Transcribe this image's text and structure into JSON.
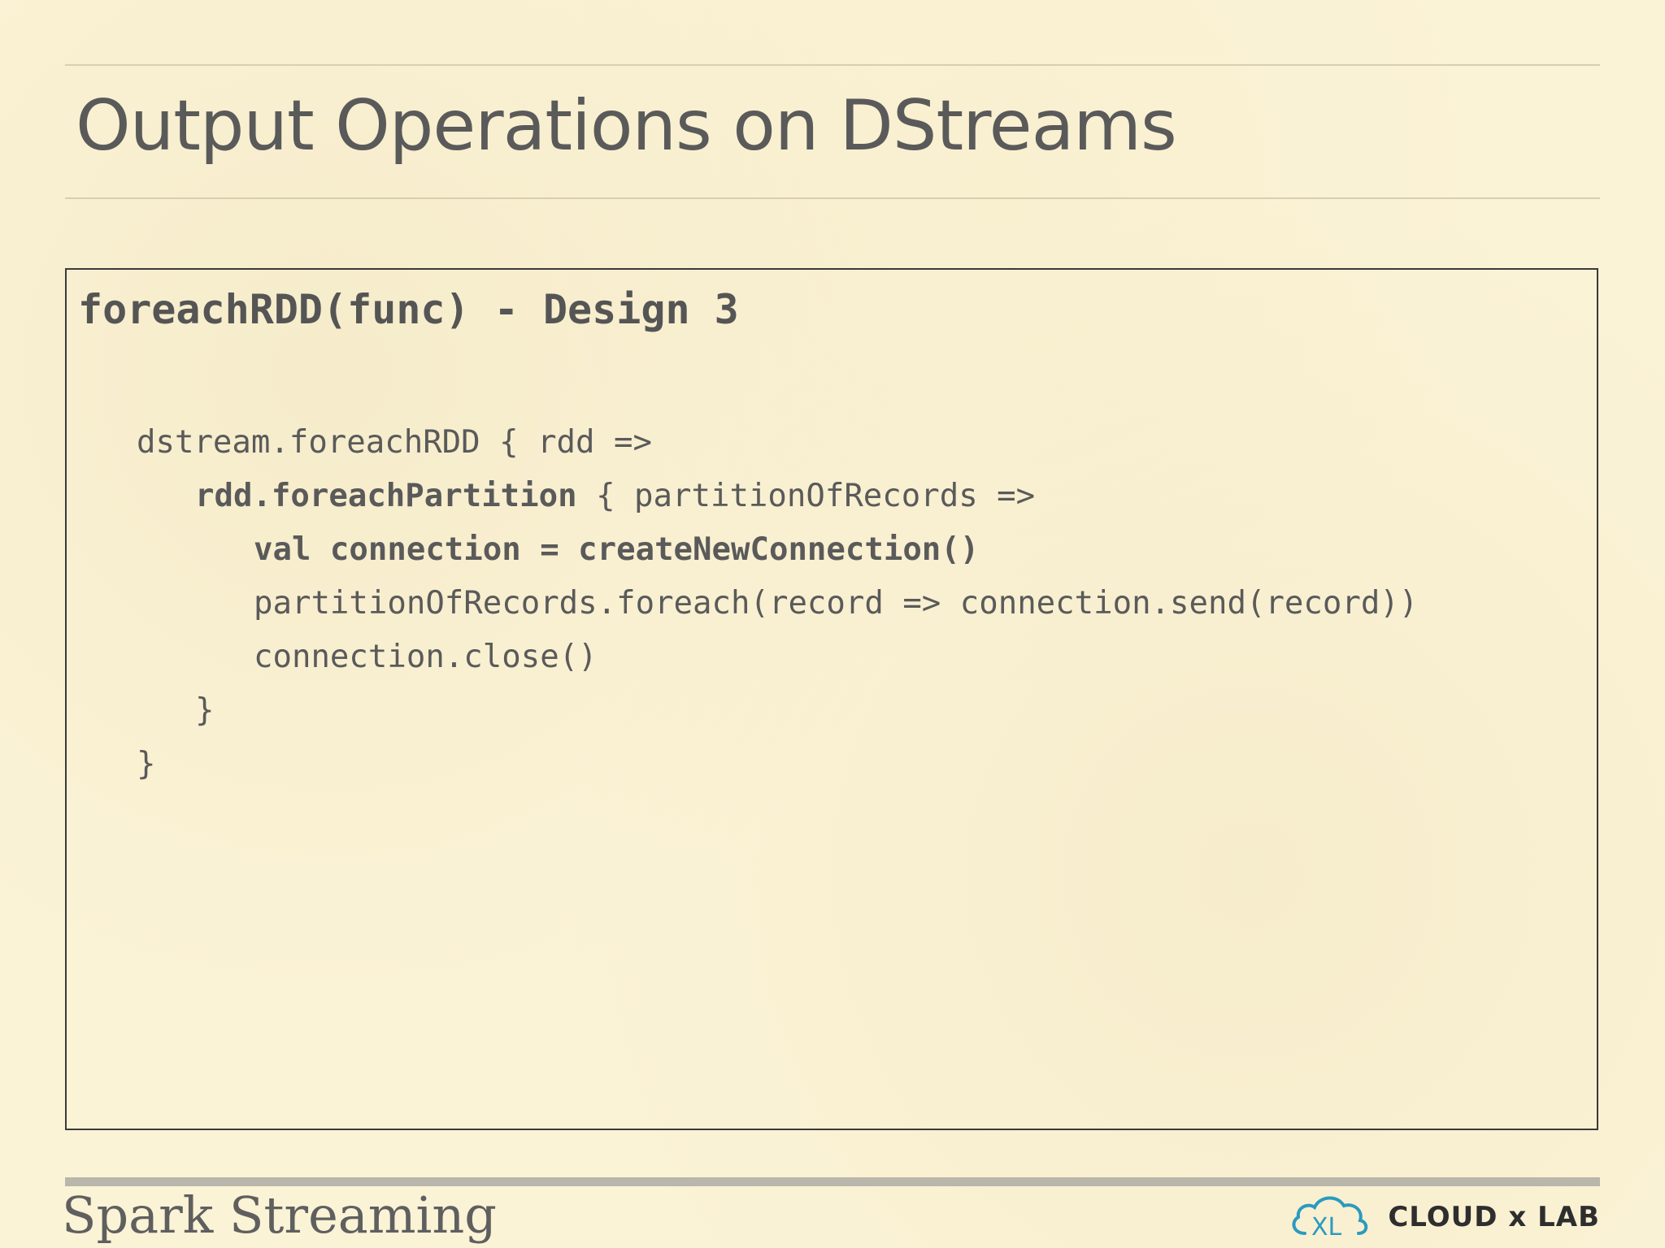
{
  "slide": {
    "title": "Output Operations on DStreams",
    "box_heading": "foreachRDD(func) - Design 3",
    "code_lines": [
      {
        "plain": "dstream.foreachRDD { rdd =>"
      },
      {
        "bold": "rdd.foreachPartition",
        "plain": " { partitionOfRecords =>"
      },
      {
        "bold": "val connection = createNewConnection()"
      },
      {
        "plain": "partitionOfRecords.foreach(record => connection.send(record))"
      },
      {
        "plain": "connection.close()"
      },
      {
        "plain": "}"
      },
      {
        "plain": "}"
      }
    ],
    "footer_title": "Spark Streaming",
    "logo": {
      "icon": "cloud-xl-icon",
      "text": "CLOUD x LAB",
      "colors": {
        "cloud": "#2a9bbf",
        "text": "#2e2e2e"
      }
    }
  },
  "colors": {
    "background": "#fbf3d6",
    "text": "#555555",
    "rule": "#d8ceb2",
    "footer_bar": "#b9b6ab",
    "box_border": "#3a3a3a"
  }
}
